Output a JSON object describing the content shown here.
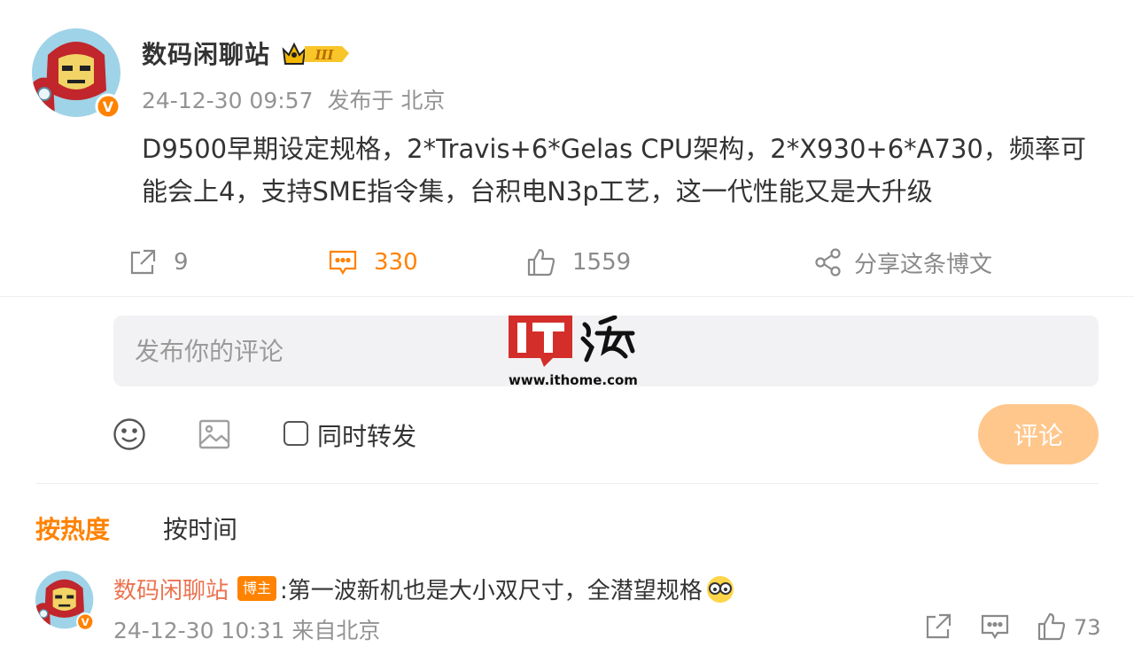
{
  "post": {
    "author": "数码闲聊站",
    "timestamp": "24-12-30 09:57",
    "location": "发布于 北京",
    "text": "D9500早期设定规格，2*Travis+6*Gelas CPU架构，2*X930+6*A730，频率可能会上4，支持SME指令集，台积电N3p工艺，这一代性能又是大升级",
    "vip_badge_text": "III",
    "verified_badge": "V",
    "accent_color": "#ff8200"
  },
  "actions": {
    "repost_count": "9",
    "comment_count": "330",
    "like_count": "1559",
    "share_label": "分享这条博文"
  },
  "composer": {
    "placeholder": "发布你的评论",
    "forward_label": "同时转发",
    "submit_label": "评论",
    "icons": [
      "emoji-icon",
      "image-icon"
    ]
  },
  "watermark": {
    "logo": "IT之家",
    "url": "www.ithome.com"
  },
  "sort_tabs": [
    "按热度",
    "按时间"
  ],
  "comments": [
    {
      "user": "数码闲聊站",
      "badge": "博主",
      "text": ":第一波新机也是大小双尺寸，全潜望规格",
      "emoji": "glasses-emoji",
      "timestamp": "24-12-30 10:31 来自北京",
      "like_count": "73"
    }
  ]
}
